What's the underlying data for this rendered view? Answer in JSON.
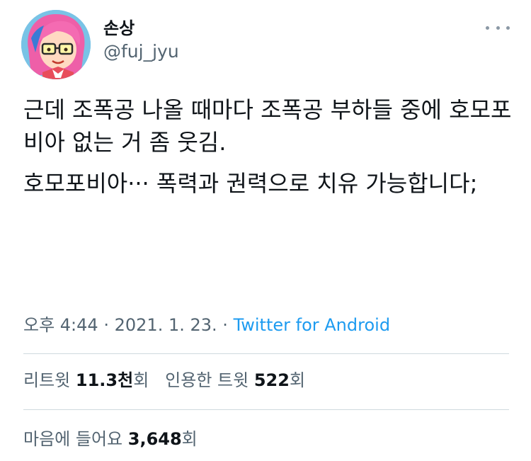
{
  "author": {
    "display_name": "손상",
    "handle": "@fuj_jyu",
    "avatar_icon": "anime-girl-avatar-icon"
  },
  "more_icon": "more-options-icon",
  "tweet": {
    "paragraphs": [
      "근데 조폭공 나올 때마다 조폭공 부하들 중에 호모포비아 없는 거 좀 웃김.",
      "호모포비아··· 폭력과 권력으로 치유 가능합니다;"
    ]
  },
  "meta": {
    "time": "오후 4:44",
    "separator": "·",
    "date": "2021. 1. 23.",
    "source": "Twitter for Android"
  },
  "stats": {
    "retweets_label": "리트윗",
    "retweets_count": "11.3천",
    "retweets_suffix": "회",
    "quotes_label": "인용한 트윗",
    "quotes_count": "522",
    "quotes_suffix": "회",
    "likes_label": "마음에 들어요",
    "likes_count": "3,648",
    "likes_suffix": "회"
  },
  "colors": {
    "text": "#0f1419",
    "secondary": "#536471",
    "link": "#1d9bf0",
    "divider": "#cfd9de"
  }
}
